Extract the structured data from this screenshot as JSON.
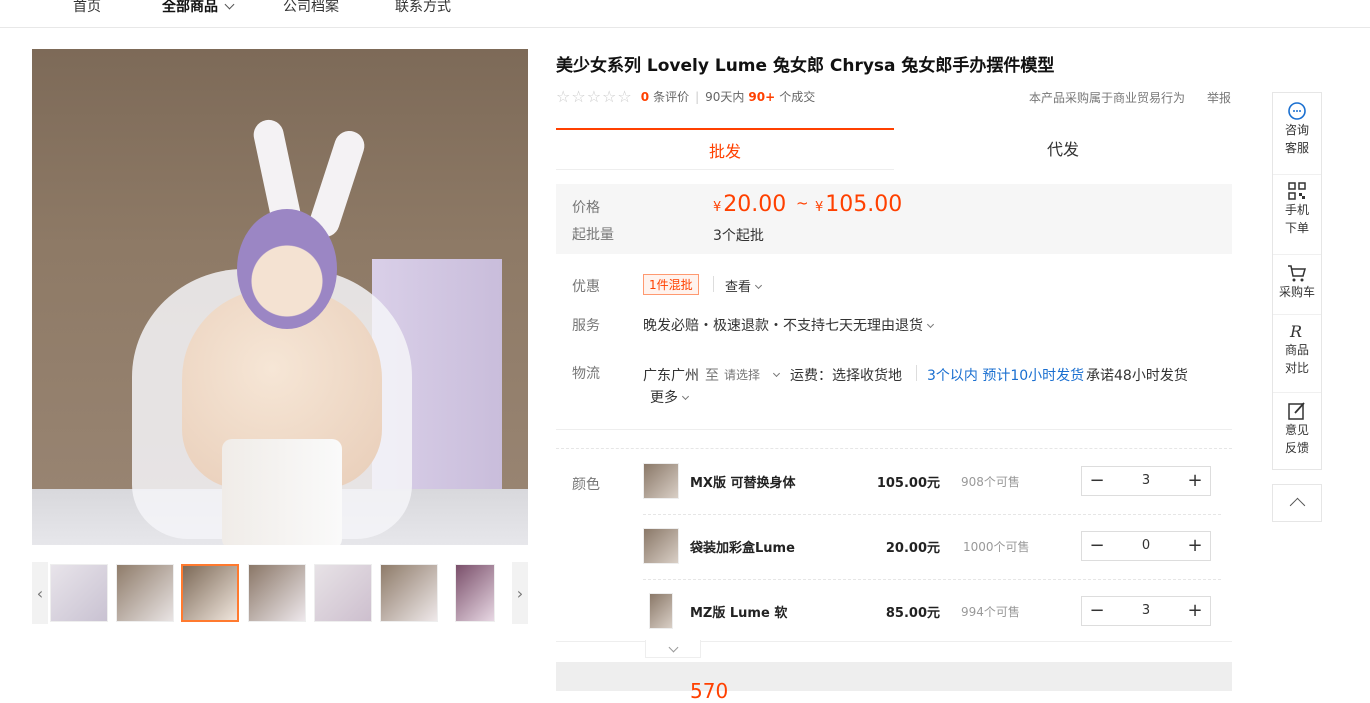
{
  "nav": {
    "items": [
      "首页",
      "全部商品",
      "公司档案",
      "联系方式"
    ]
  },
  "product": {
    "title": "美少女系列 Lovely Lume 兔女郎 Chrysa 兔女郎手办摆件模型",
    "rating_count": "0",
    "rating_label": "条评价",
    "sales_prefix": "90天内",
    "sales_count": "90+",
    "sales_suffix": "个成交",
    "biz_note": "本产品采购属于商业贸易行为",
    "report": "举报"
  },
  "tabs": [
    "批发",
    "代发"
  ],
  "price": {
    "label": "价格",
    "currency": "¥",
    "low": "20.00",
    "range_sep": "~",
    "high": "105.00",
    "moq_label": "起批量",
    "moq_value": "3个起批"
  },
  "offers": {
    "label": "优惠",
    "badge": "1件混批",
    "view": "查看"
  },
  "service": {
    "label": "服务",
    "text": "晚发必赔・极速退款・不支持七天无理由退货"
  },
  "logistics": {
    "label": "物流",
    "from": "广东广州",
    "to_word": "至",
    "choose": "请选择",
    "freight": "运费：选择收货地",
    "ship_promise": "3个以内 预计10小时发货",
    "commit": "承诺48小时发货",
    "more": "更多"
  },
  "sku": {
    "label": "颜色",
    "items": [
      {
        "name": "MX版 可替换身体",
        "price": "105.00元",
        "stock": "908个可售",
        "qty": "3"
      },
      {
        "name": "袋装加彩盒Lume",
        "price": "20.00元",
        "stock": "1000个可售",
        "qty": "0"
      },
      {
        "name": "MZ版 Lume 软",
        "price": "85.00元",
        "stock": "994个可售",
        "qty": "3"
      }
    ]
  },
  "footer": {
    "total": "570"
  },
  "sidebar": {
    "items": [
      {
        "label1": "咨询",
        "label2": "客服",
        "icon": "chat-icon"
      },
      {
        "label1": "手机",
        "label2": "下单",
        "icon": "qrcode-icon"
      },
      {
        "label1": "采购车",
        "label2": "",
        "icon": "cart-icon"
      },
      {
        "label1": "商品",
        "label2": "对比",
        "icon": "compare-icon"
      },
      {
        "label1": "意见",
        "label2": "反馈",
        "icon": "edit-icon"
      }
    ]
  },
  "colors": {
    "accent": "#ff4000",
    "link": "#1a6fd0"
  }
}
